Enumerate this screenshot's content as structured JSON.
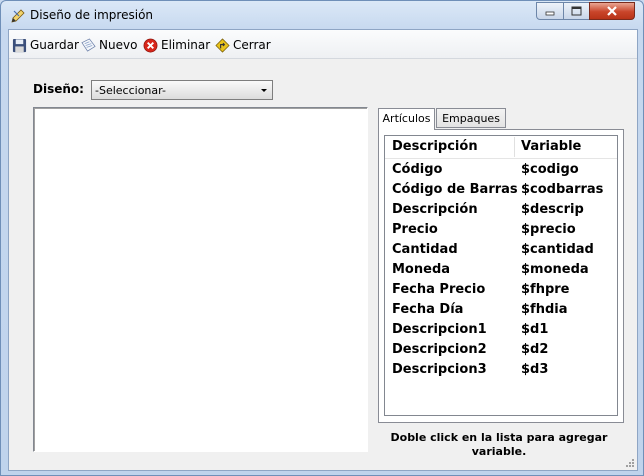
{
  "window": {
    "title": "Diseño de impresión"
  },
  "toolbar": {
    "save_label": "Guardar",
    "new_label": "Nuevo",
    "delete_label": "Eliminar",
    "close_label": "Cerrar"
  },
  "design": {
    "label": "Diseño:",
    "selected": "-Seleccionar-"
  },
  "tabs": [
    {
      "label": "Artículos",
      "active": true
    },
    {
      "label": "Empaques",
      "active": false
    }
  ],
  "list": {
    "columns": [
      "Descripción",
      "Variable"
    ],
    "rows": [
      {
        "desc": "Código",
        "var": "$codigo"
      },
      {
        "desc": "Código de Barras",
        "var": "$codbarras"
      },
      {
        "desc": "Descripción",
        "var": "$descrip"
      },
      {
        "desc": "Precio",
        "var": "$precio"
      },
      {
        "desc": "Cantidad",
        "var": "$cantidad"
      },
      {
        "desc": "Moneda",
        "var": "$moneda"
      },
      {
        "desc": "Fecha Precio",
        "var": "$fhpre"
      },
      {
        "desc": "Fecha Día",
        "var": "$fhdia"
      },
      {
        "desc": "Descripcion1",
        "var": "$d1"
      },
      {
        "desc": "Descripcion2",
        "var": "$d2"
      },
      {
        "desc": "Descripcion3",
        "var": "$d3"
      }
    ]
  },
  "hint": "Doble click en la lista para agregar variable.",
  "icons": {
    "title": "pencil-icon",
    "save": "floppy-disk-icon",
    "new": "new-document-icon",
    "delete": "red-x-circle-icon",
    "close": "exit-sign-icon"
  },
  "colors": {
    "close_button": "#c9452a",
    "delete_icon": "#d8261b",
    "close_icon": "#e8c21b"
  }
}
